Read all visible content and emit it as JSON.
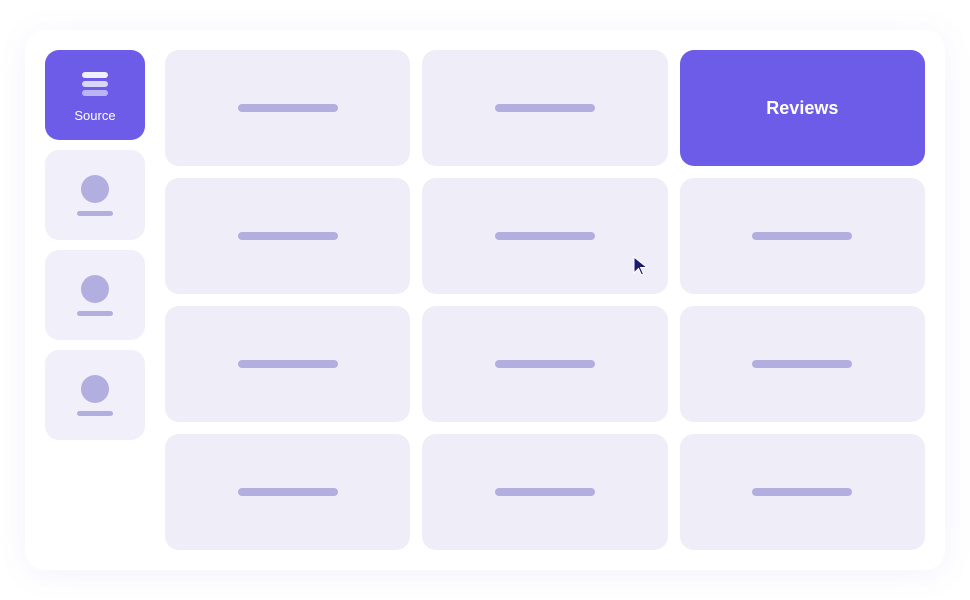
{
  "sidebar": {
    "items": [
      {
        "id": "source",
        "label": "Source",
        "active": true,
        "icon": "layers"
      },
      {
        "id": "user1",
        "label": "",
        "active": false,
        "icon": "avatar"
      },
      {
        "id": "user2",
        "label": "",
        "active": false,
        "icon": "avatar"
      },
      {
        "id": "user3",
        "label": "",
        "active": false,
        "icon": "avatar"
      }
    ]
  },
  "grid": {
    "rows": [
      [
        {
          "id": "r1c1",
          "label": "",
          "highlighted": false
        },
        {
          "id": "r1c2",
          "label": "",
          "highlighted": false
        },
        {
          "id": "r1c3",
          "label": "Reviews",
          "highlighted": true
        }
      ],
      [
        {
          "id": "r2c1",
          "label": "",
          "highlighted": false
        },
        {
          "id": "r2c2",
          "label": "",
          "highlighted": false
        },
        {
          "id": "r2c3",
          "label": "",
          "highlighted": false
        }
      ],
      [
        {
          "id": "r3c1",
          "label": "",
          "highlighted": false
        },
        {
          "id": "r3c2",
          "label": "",
          "highlighted": false
        },
        {
          "id": "r3c3",
          "label": "",
          "highlighted": false
        }
      ],
      [
        {
          "id": "r4c1",
          "label": "",
          "highlighted": false
        },
        {
          "id": "r4c2",
          "label": "",
          "highlighted": false
        },
        {
          "id": "r4c3",
          "label": "",
          "highlighted": false
        }
      ]
    ],
    "reviews_label": "Reviews"
  },
  "cursor": {
    "visible": true,
    "position": "row2-col2"
  }
}
